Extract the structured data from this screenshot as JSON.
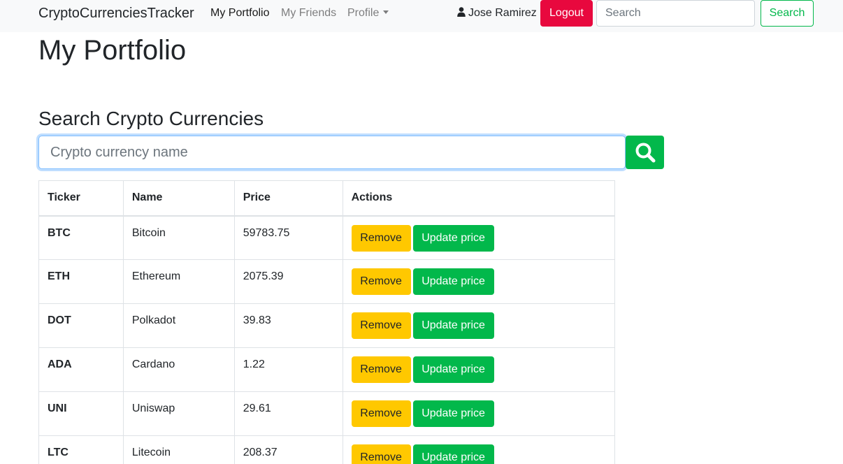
{
  "navbar": {
    "brand": "CryptoCurrenciesTracker",
    "links": {
      "portfolio": "My Portfolio",
      "friends": "My Friends",
      "profile": "Profile"
    },
    "user_name": "Jose Ramirez",
    "logout_label": "Logout",
    "search_placeholder": "Search",
    "search_button": "Search"
  },
  "page": {
    "title": "My Portfolio",
    "search_section_title": "Search Crypto Currencies",
    "crypto_search_placeholder": "Crypto currency name"
  },
  "table": {
    "headers": {
      "ticker": "Ticker",
      "name": "Name",
      "price": "Price",
      "actions": "Actions"
    },
    "remove_label": "Remove",
    "update_label": "Update price",
    "rows": [
      {
        "ticker": "BTC",
        "name": "Bitcoin",
        "price": "59783.75"
      },
      {
        "ticker": "ETH",
        "name": "Ethereum",
        "price": "2075.39"
      },
      {
        "ticker": "DOT",
        "name": "Polkadot",
        "price": "39.83"
      },
      {
        "ticker": "ADA",
        "name": "Cardano",
        "price": "1.22"
      },
      {
        "ticker": "UNI",
        "name": "Uniswap",
        "price": "29.61"
      },
      {
        "ticker": "LTC",
        "name": "Litecoin",
        "price": "208.37"
      }
    ]
  },
  "colors": {
    "danger": "#e8083e",
    "success": "#02b84b",
    "warning": "#ffc800",
    "navbar_bg": "#f8f9fa"
  },
  "icons": {
    "user": "user-icon",
    "search": "search-icon",
    "caret": "chevron-down-icon"
  }
}
